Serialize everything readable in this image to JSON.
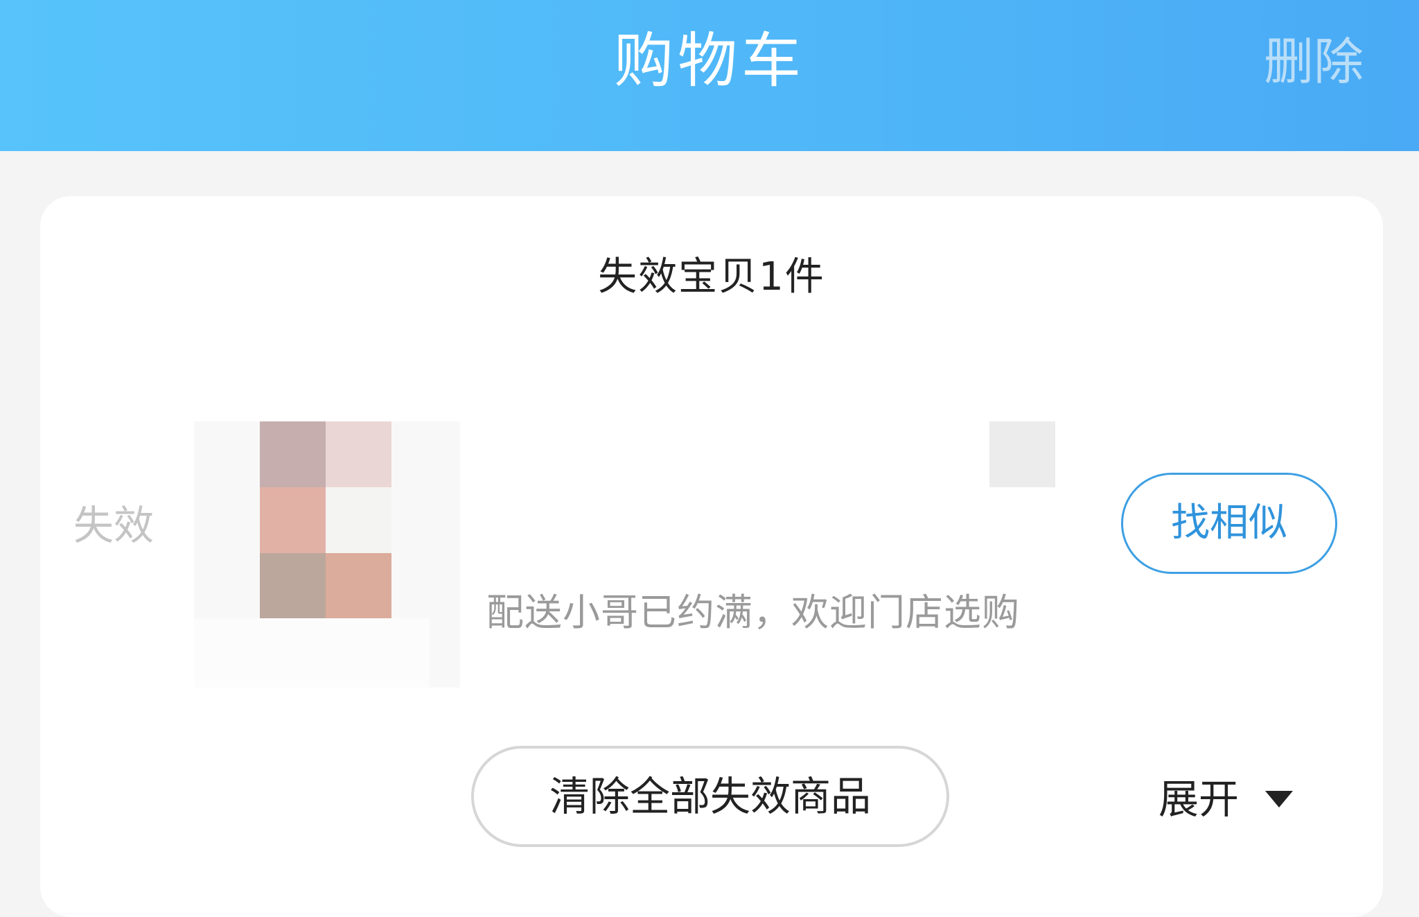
{
  "header": {
    "title": "购物车",
    "action_label": "删除",
    "colors": {
      "gradient_start": "#57c3fa",
      "gradient_end": "#4aaaf5"
    }
  },
  "invalid_section": {
    "title": "失效宝贝1件",
    "item": {
      "status_tag": "失效",
      "thumbnail_icon": "pixelated-product-image",
      "message": "配送小哥已约满，欢迎门店选购",
      "find_similar_label": "找相似"
    },
    "clear_all_label": "清除全部失效商品",
    "expand_label": "展开",
    "expand_icon": "caret-down-icon"
  },
  "colors": {
    "page_background": "#f4f4f4",
    "accent": "#2f93dc",
    "muted_text": "#9a9a9a"
  }
}
